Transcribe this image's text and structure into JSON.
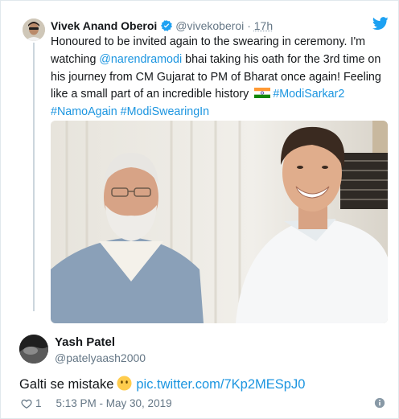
{
  "quoted_tweet": {
    "author_name": "Vivek Anand Oberoi",
    "handle": "@vivekoberoi",
    "separator": "·",
    "time_ago": "17h",
    "text_part1": "Honoured to be invited again to the swearing in ceremony. I'm watching ",
    "mention": "@narendramodi",
    "text_part2": " bhai taking his oath for the 3rd time on his journey from CM Gujarat to PM of Bharat once again! Feeling like a small part of an incredible history ",
    "hashtag1": "#ModiSarkar2",
    "hashtag2": "#NamoAgain",
    "hashtag3": "#ModiSwearingIn",
    "flag_icon": "india-flag-emoji",
    "verified_icon": "verified-badge-icon",
    "brand_icon": "twitter-bird-icon"
  },
  "reply_tweet": {
    "author_name": "Yash Patel",
    "handle": "@patelyaash2000",
    "text": "Galti se mistake",
    "emoji_icon": "no-mouth-face-emoji",
    "link": "pic.twitter.com/7Kp2MESpJ0",
    "like_count": "1",
    "timestamp": "5:13 PM - May 30, 2019",
    "info_icon": "info-icon"
  },
  "colors": {
    "link": "#1b95e0",
    "text": "#14171a",
    "muted": "#657786",
    "thread_line": "#ccd6dd",
    "twitter_blue": "#1da1f2"
  }
}
